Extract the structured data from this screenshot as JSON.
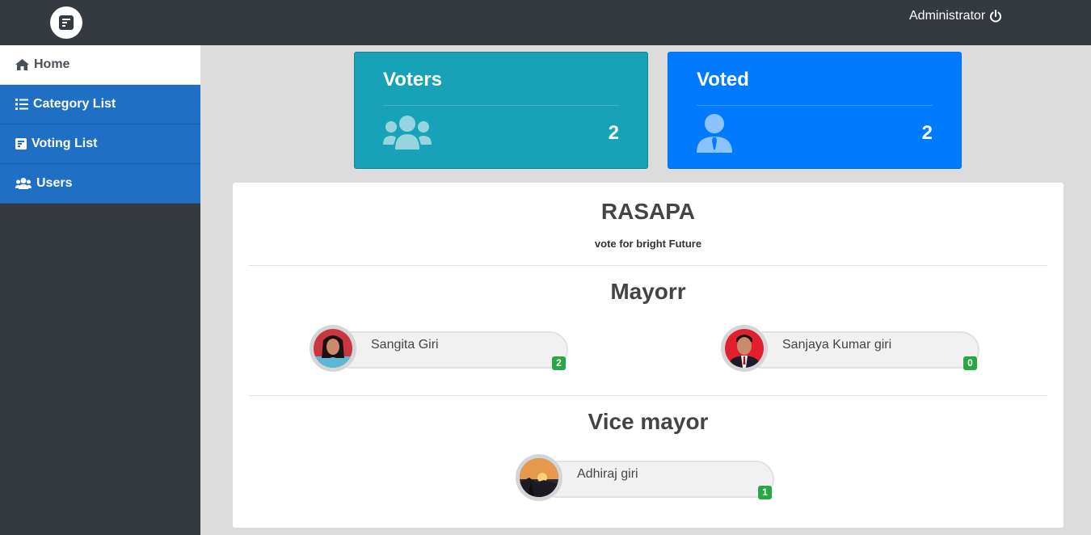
{
  "header": {
    "logo_icon": "ballot-icon",
    "user_label": "Administrator",
    "user_icon": "power-icon"
  },
  "sidebar": {
    "items": [
      {
        "label": "Home",
        "icon": "home-icon",
        "active": true
      },
      {
        "label": "Category List",
        "icon": "list-icon",
        "active": false
      },
      {
        "label": "Voting List",
        "icon": "ballot-icon",
        "active": false
      },
      {
        "label": "Users",
        "icon": "users-icon",
        "active": false
      }
    ]
  },
  "stats": {
    "voters": {
      "title": "Voters",
      "count": "2",
      "icon": "users-icon",
      "color": "#17a2b8"
    },
    "voted": {
      "title": "Voted",
      "count": "2",
      "icon": "user-tie-icon",
      "color": "#007bff"
    }
  },
  "party": {
    "name": "RASAPA",
    "slogan": "vote for bright Future"
  },
  "categories": [
    {
      "title": "Mayorr",
      "candidates": [
        {
          "name": "Sangita Giri",
          "votes": "2"
        },
        {
          "name": "Sanjaya Kumar giri",
          "votes": "0"
        }
      ]
    },
    {
      "title": "Vice mayor",
      "candidates": [
        {
          "name": "Adhiraj giri",
          "votes": "1"
        }
      ]
    }
  ],
  "colors": {
    "topbar": "#343a40",
    "sidebar_active_bg": "#1f6fc4",
    "badge": "#28a745"
  }
}
